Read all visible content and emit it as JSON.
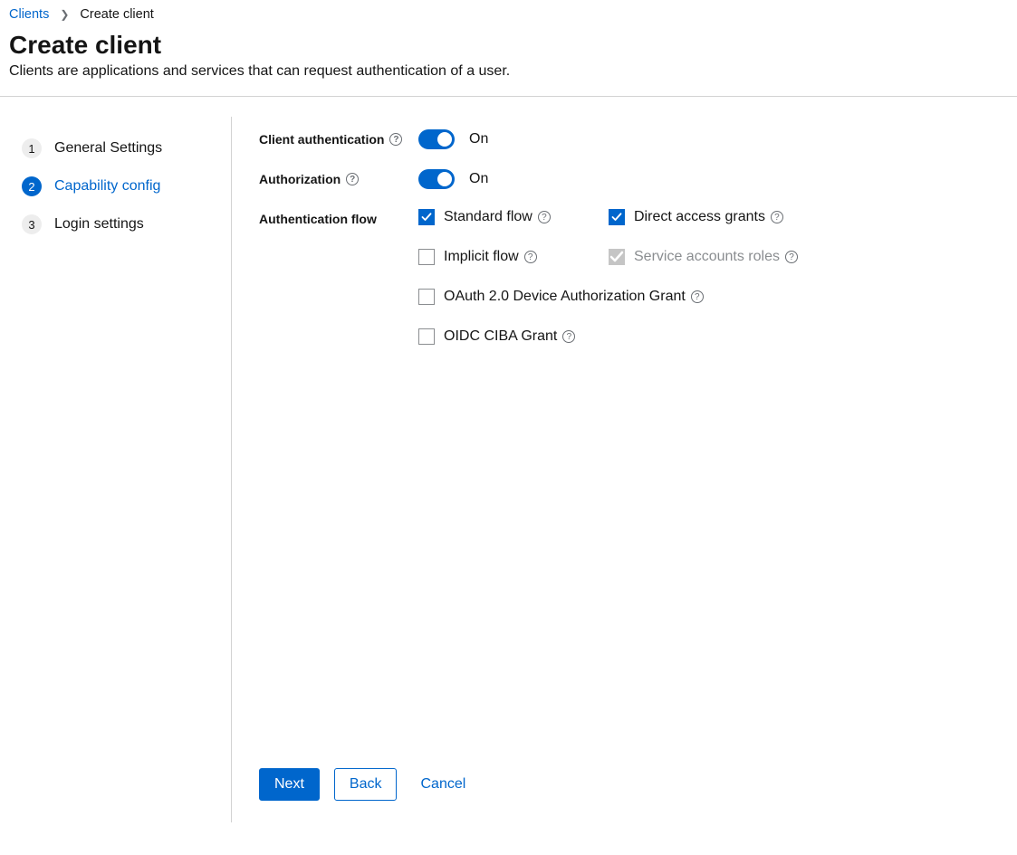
{
  "breadcrumb": {
    "parent": "Clients",
    "current": "Create client"
  },
  "header": {
    "title": "Create client",
    "description": "Clients are applications and services that can request authentication of a user."
  },
  "wizard": {
    "steps": [
      {
        "num": "1",
        "label": "General Settings"
      },
      {
        "num": "2",
        "label": "Capability config"
      },
      {
        "num": "3",
        "label": "Login settings"
      }
    ],
    "active_index": 1
  },
  "form": {
    "client_auth": {
      "label": "Client authentication",
      "state": "On"
    },
    "authorization": {
      "label": "Authorization",
      "state": "On"
    },
    "auth_flow": {
      "label": "Authentication flow",
      "options": {
        "standard": {
          "label": "Standard flow"
        },
        "direct": {
          "label": "Direct access grants"
        },
        "implicit": {
          "label": "Implicit flow"
        },
        "service": {
          "label": "Service accounts roles"
        },
        "oauth_dev": {
          "label": "OAuth 2.0 Device Authorization Grant"
        },
        "ciba": {
          "label": "OIDC CIBA Grant"
        }
      }
    }
  },
  "footer": {
    "next": "Next",
    "back": "Back",
    "cancel": "Cancel"
  }
}
